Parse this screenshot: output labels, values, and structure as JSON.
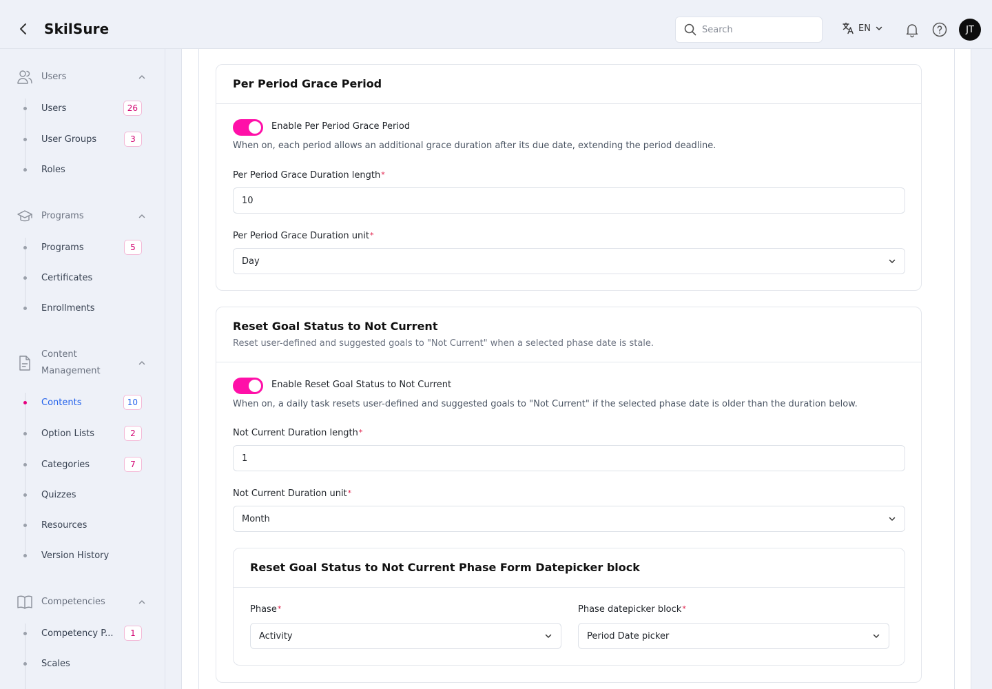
{
  "app": {
    "title": "SkilSure"
  },
  "header": {
    "search_placeholder": "Search",
    "language": "EN",
    "avatar_initials": "JT"
  },
  "sidebar": {
    "sections": [
      {
        "label": "Users",
        "icon": "users-icon",
        "items": [
          {
            "label": "Users",
            "count": "26"
          },
          {
            "label": "User Groups",
            "count": "3"
          },
          {
            "label": "Roles",
            "count": null
          }
        ]
      },
      {
        "label": "Programs",
        "icon": "graduation-cap-icon",
        "items": [
          {
            "label": "Programs",
            "count": "5"
          },
          {
            "label": "Certificates",
            "count": null
          },
          {
            "label": "Enrollments",
            "count": null
          }
        ]
      },
      {
        "label_line1": "Content",
        "label_line2": "Management",
        "icon": "document-icon",
        "items": [
          {
            "label": "Contents",
            "count": "10",
            "active": true
          },
          {
            "label": "Option Lists",
            "count": "2"
          },
          {
            "label": "Categories",
            "count": "7"
          },
          {
            "label": "Quizzes",
            "count": null
          },
          {
            "label": "Resources",
            "count": null
          },
          {
            "label": "Version History",
            "count": null
          }
        ]
      },
      {
        "label": "Competencies",
        "icon": "book-icon",
        "items": [
          {
            "label": "Competency P...",
            "count": "1"
          },
          {
            "label": "Scales",
            "count": null
          }
        ]
      }
    ]
  },
  "grace_card": {
    "title": "Per Period Grace Period",
    "toggle_label": "Enable Per Period Grace Period",
    "toggle_on": true,
    "help": "When on, each period allows an additional grace duration after its due date, extending the period deadline.",
    "length_label": "Per Period Grace Duration length",
    "length_value": "10",
    "unit_label": "Per Period Grace Duration unit",
    "unit_value": "Day"
  },
  "reset_card": {
    "title": "Reset Goal Status to Not Current",
    "description": "Reset user-defined and suggested goals to \"Not Current\" when a selected phase date is stale.",
    "toggle_label": "Enable Reset Goal Status to Not Current",
    "toggle_on": true,
    "help": "When on, a daily task resets user-defined and suggested goals to \"Not Current\" if the selected phase date is older than the duration below.",
    "length_label": "Not Current Duration length",
    "length_value": "1",
    "unit_label": "Not Current Duration unit",
    "unit_value": "Month",
    "phase_block": {
      "title": "Reset Goal Status to Not Current Phase Form Datepicker block",
      "phase_label": "Phase",
      "phase_value": "Activity",
      "datepicker_label": "Phase datepicker block",
      "datepicker_value": "Period Date picker"
    }
  },
  "colors": {
    "accent": "#ff10a8",
    "active_link": "#2563eb",
    "required": "#e11d48"
  }
}
